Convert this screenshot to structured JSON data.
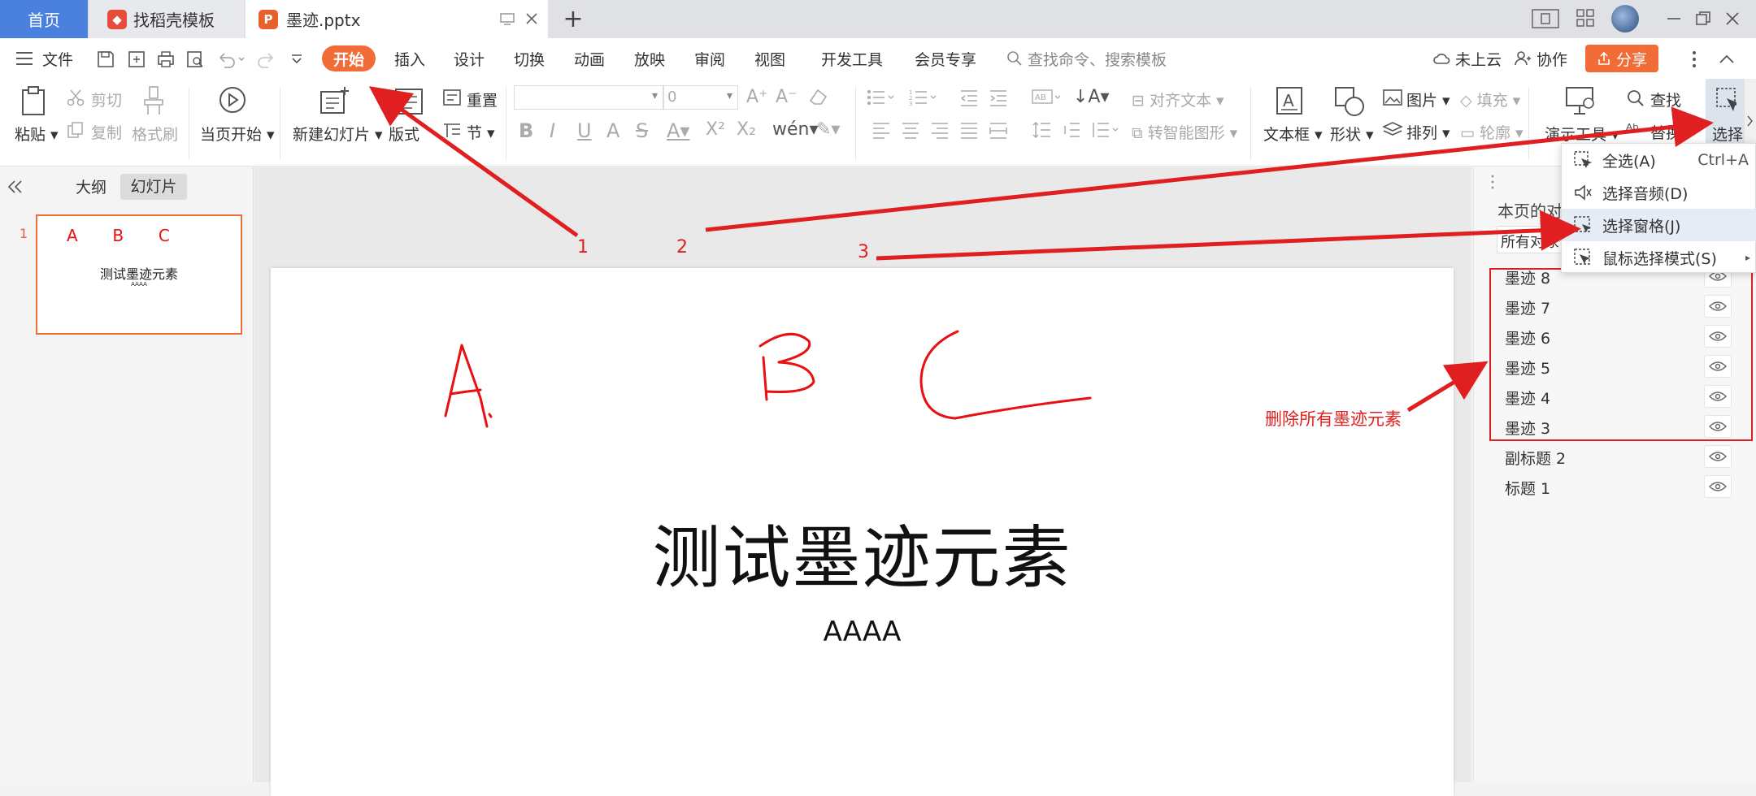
{
  "tabs": {
    "home": "首页",
    "templates": "找稻壳模板",
    "document": "墨迹.pptx",
    "document_icon": "P",
    "add": "+"
  },
  "menu": {
    "file": "文件",
    "items": [
      "开始",
      "插入",
      "设计",
      "切换",
      "动画",
      "放映",
      "审阅",
      "视图",
      "开发工具",
      "会员专享"
    ],
    "search": "查找命令、搜索模板",
    "cloud": "未上云",
    "collab": "协作",
    "share": "分享"
  },
  "ribbon": {
    "paste": "粘贴",
    "cut": "剪切",
    "copy": "复制",
    "format_painter": "格式刷",
    "play_current": "当页开始",
    "new_slide": "新建幻灯片",
    "layout": "版式",
    "reset": "重置",
    "section": "节",
    "font_size": "0",
    "align_text": "对齐文本",
    "smart_art": "转智能图形",
    "text_box": "文本框",
    "shape": "形状",
    "picture": "图片",
    "arrange": "排列",
    "fill": "填充",
    "outline": "轮廓",
    "present_tools": "演示工具",
    "find": "查找",
    "replace": "替换",
    "select": "选择"
  },
  "left_panel": {
    "tab_outline": "大纲",
    "tab_slides": "幻灯片",
    "slide_number": "1",
    "thumb_ink": "A  B  C",
    "thumb_title": "测试墨迹元素",
    "thumb_sub": "AAAA"
  },
  "slide": {
    "title": "测试墨迹元素",
    "subtitle": "AAAA"
  },
  "right_panel": {
    "heading": "本页的对",
    "filter": "所有对象",
    "objects": [
      "墨迹 8",
      "墨迹 7",
      "墨迹 6",
      "墨迹 5",
      "墨迹 4",
      "墨迹 3",
      "副标题 2",
      "标题 1"
    ]
  },
  "dropdown": {
    "items": [
      {
        "label": "全选(A)",
        "shortcut": "Ctrl+A"
      },
      {
        "label": "选择音频(D)",
        "shortcut": ""
      },
      {
        "label": "选择窗格(J)",
        "shortcut": ""
      },
      {
        "label": "鼠标选择模式(S)",
        "shortcut": ""
      }
    ]
  },
  "annotations": {
    "n1": "1",
    "n2": "2",
    "n3": "3",
    "note": "删除所有墨迹元素"
  },
  "colors": {
    "accent": "#f16c37",
    "home_tab": "#4a80de",
    "annotation": "#e02020",
    "ink": "#e81010"
  }
}
